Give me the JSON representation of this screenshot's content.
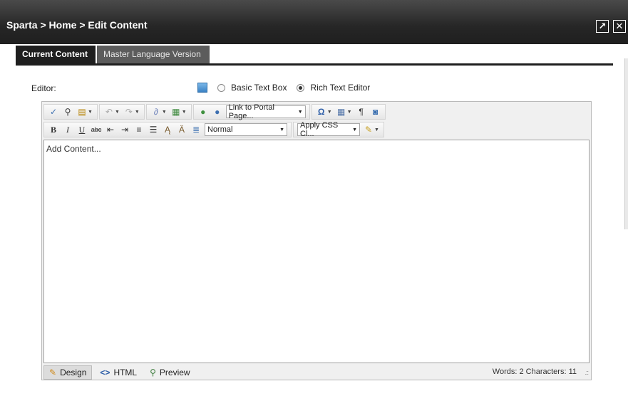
{
  "window": {
    "breadcrumb": "Sparta > Home > Edit Content",
    "maximize_glyph": "↗",
    "close_glyph": "✕"
  },
  "tabs": [
    {
      "label": "Current Content",
      "active": true
    },
    {
      "label": "Master Language Version",
      "active": false
    }
  ],
  "editor": {
    "label": "Editor:",
    "options": [
      {
        "label": "Basic Text Box",
        "selected": false
      },
      {
        "label": "Rich Text Editor",
        "selected": true
      }
    ]
  },
  "toolbar": {
    "link_select": "Link to Portal Page...",
    "format_select": "Normal",
    "css_select": "Apply CSS Cl...",
    "bold": "B",
    "italic": "I",
    "underline": "U",
    "strike": "abc",
    "omega": "Ω",
    "pilcrow": "¶"
  },
  "content": {
    "text": "Add Content..."
  },
  "bottom": {
    "modes": [
      {
        "label": "Design",
        "icon": "pencil-icon",
        "active": true
      },
      {
        "label": "HTML",
        "icon": "code-icon",
        "active": false
      },
      {
        "label": "Preview",
        "icon": "magnifier-icon",
        "active": false
      }
    ],
    "counts": "Words: 2  Characters: 11"
  },
  "colors": {
    "titlebar": "#262626",
    "tab_active": "#1f1f1f",
    "tab_inactive": "#5c5c5c"
  }
}
